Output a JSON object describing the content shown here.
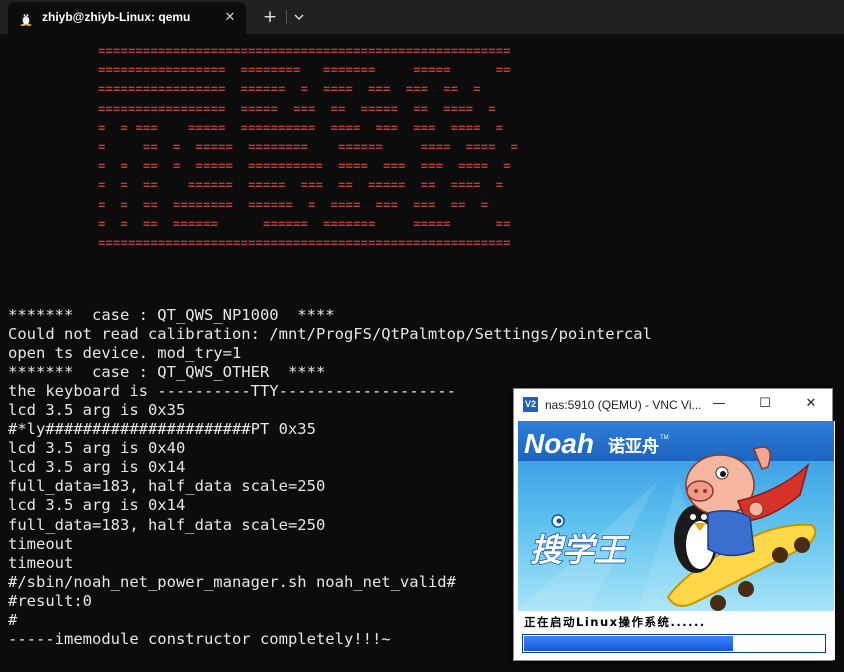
{
  "tabbar": {
    "tab_title": "zhiyb@zhiyb-Linux: qemu",
    "tab_icon": "linux-penguin-icon",
    "close_glyph": "✕",
    "new_tab_glyph": "+",
    "dropdown_icon": "chevron-down-icon"
  },
  "banner": {
    "color": "#c03838",
    "lines": [
      "=======================================================",
      "=================  ========   =======     =====      ==",
      "=================  ======  =  ====  ===  ===  ==  =",
      "=================  =====  ===  ==  =====  ==  ====  =",
      "=  = ===    =====  ==========  ====  ===  ===  ====  =",
      "=     ==  =  =====  ========    ======     ====  ====  =",
      "=  =  ==  =  =====  ==========  ====  ===  ===  ====  =",
      "=  =  ==    ======  =====  ===  ==  =====  ==  ====  =",
      "=  =  ==  ========  ======  =  ====  ===  ===  ==  =",
      "=  =  ==  ======      ======  =======     =====      ==",
      "======================================================="
    ]
  },
  "terminal": {
    "lines": [
      "*******  case : QT_QWS_NP1000  ****",
      "Could not read calibration: /mnt/ProgFS/QtPalmtop/Settings/pointercal",
      "open ts device. mod_try=1",
      "*******  case : QT_QWS_OTHER  ****",
      "the keyboard is ----------TTY-------------------",
      "lcd 3.5 arg is 0x35",
      "#*ly######################PT 0x35",
      "lcd 3.5 arg is 0x40",
      "lcd 3.5 arg is 0x14",
      "full_data=183, half_data scale=250",
      "lcd 3.5 arg is 0x14",
      "full_data=183, half_data scale=250",
      "timeout",
      "timeout",
      "#/sbin/noah_net_power_manager.sh noah_net_valid#",
      "#result:0",
      "#",
      "-----imemodule constructor completely!!!~"
    ]
  },
  "vnc_window": {
    "app_icon_text": "V2",
    "title": "nas:5910 (QEMU) - VNC Vi...",
    "minimize_glyph": "—",
    "maximize_glyph": "☐",
    "close_glyph": "✕",
    "boot_status": "正在启动Linux操作系统......",
    "progress": 0.7,
    "splash": {
      "brand_text": "Noah",
      "brand_chinese": "诺亚舟",
      "trademark": "TM",
      "product_name": "搜学王"
    }
  }
}
